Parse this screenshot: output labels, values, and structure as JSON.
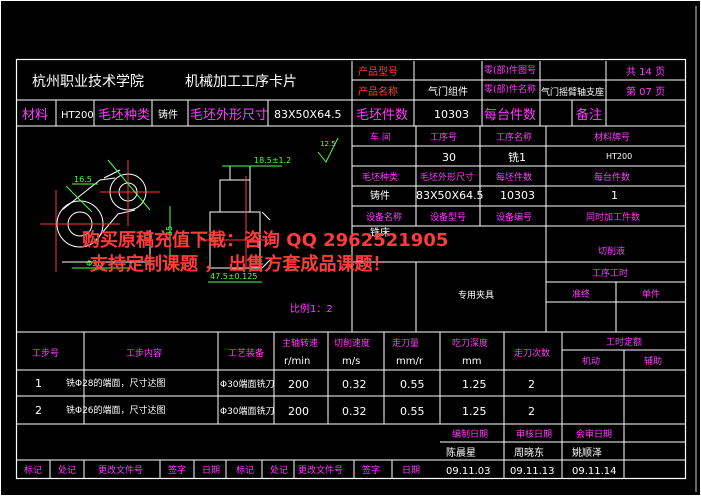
{
  "header": {
    "school": "杭州职业技术学院",
    "card_title": "机械加工工序卡片",
    "product_model_label": "产品型号",
    "product_name_label": "产品名称",
    "product_name": "气门组件",
    "part_no_label": "零(部)件图号",
    "part_name_label": "零(部)件名称",
    "part_name": "气门摇臂轴支座",
    "total_pages": "共 14 页",
    "page_no": "第 07 页"
  },
  "material_row": {
    "material_label": "材料",
    "material": "HT200",
    "blank_type_label": "毛坯种类",
    "blank_type": "铸件",
    "blank_size_label": "毛坯外形尺寸",
    "blank_size": "83X50X64.5",
    "blank_count_label": "毛坯件数",
    "blank_count": "10303",
    "per_unit_label": "每台件数",
    "remarks_label": "备注"
  },
  "info_grid": {
    "workshop_label": "车 间",
    "op_no_label": "工序号",
    "op_name_label": "工序名称",
    "mat_grade_label": "材料牌号",
    "op_no": "30",
    "op_name": "铣1",
    "mat_grade": "HT200",
    "blank_type_label": "毛坯种类",
    "blank_size_label": "毛坯外形尺寸",
    "blank_count_label": "每坯件数",
    "per_unit_label": "每台件数",
    "blank_type": "铸件",
    "blank_size": "83X50X64.5",
    "blank_count": "10303",
    "per_unit": "1",
    "equip_name_label": "设备名称",
    "equip_model_label": "设备型号",
    "equip_no_label": "设备编号",
    "simul_label": "同时加工件数",
    "equip_name": "铣床",
    "coolant_label": "切削液",
    "fixture": "专用夹具",
    "op_hours_label": "工序工时",
    "prep_label": "准终",
    "unit_label": "单件"
  },
  "drawing": {
    "dim_top": "18.5±1.2",
    "dim_left": "16.5",
    "dim_bottom_left": "Φ3b",
    "dim_bottom_right": "47.5±0.125",
    "roughness": "12.5",
    "dim_vertical": "35",
    "scale": "比例1：2"
  },
  "watermark": {
    "line1": "购买原稿充值下载：咨询 QQ 2962521905",
    "line2": "支持定制课题 ， 出售方套成品课题！"
  },
  "steps_table": {
    "headers": [
      "工步号",
      "工步内容",
      "工艺装备",
      "主轴转速",
      "切削速度",
      "走刀量",
      "吃刀深度",
      "走刀次数",
      "工时定额"
    ],
    "units": [
      "r/min",
      "m/s",
      "mm/r",
      "mm"
    ],
    "time_sub": [
      "机动",
      "辅助"
    ],
    "rows": [
      {
        "no": "1",
        "content": "铣Φ28的端面，尺寸达图",
        "tool": "Φ30端面铣刀",
        "speed": "200",
        "vc": "0.32",
        "feed": "0.55",
        "depth": "1.25",
        "passes": "2"
      },
      {
        "no": "2",
        "content": "铣Φ26的端面，尺寸达图",
        "tool": "Φ30端面铣刀",
        "speed": "200",
        "vc": "0.32",
        "feed": "0.55",
        "depth": "1.25",
        "passes": "2"
      }
    ]
  },
  "signoff": {
    "edit_date_label": "编制日期",
    "review_date_label": "审核日期",
    "sign_date_label": "会审日期",
    "editor": "陈晨星",
    "reviewer": "周晓东",
    "signer": "姚顺泽",
    "edit_date": "09.11.03",
    "review_date": "09.11.13",
    "sign_date": "09.11.14",
    "bottom_labels": [
      "标记",
      "处记",
      "更改文件号",
      "签字",
      "日期",
      "标记",
      "处记",
      "更改文件号",
      "签字",
      "日期"
    ]
  }
}
